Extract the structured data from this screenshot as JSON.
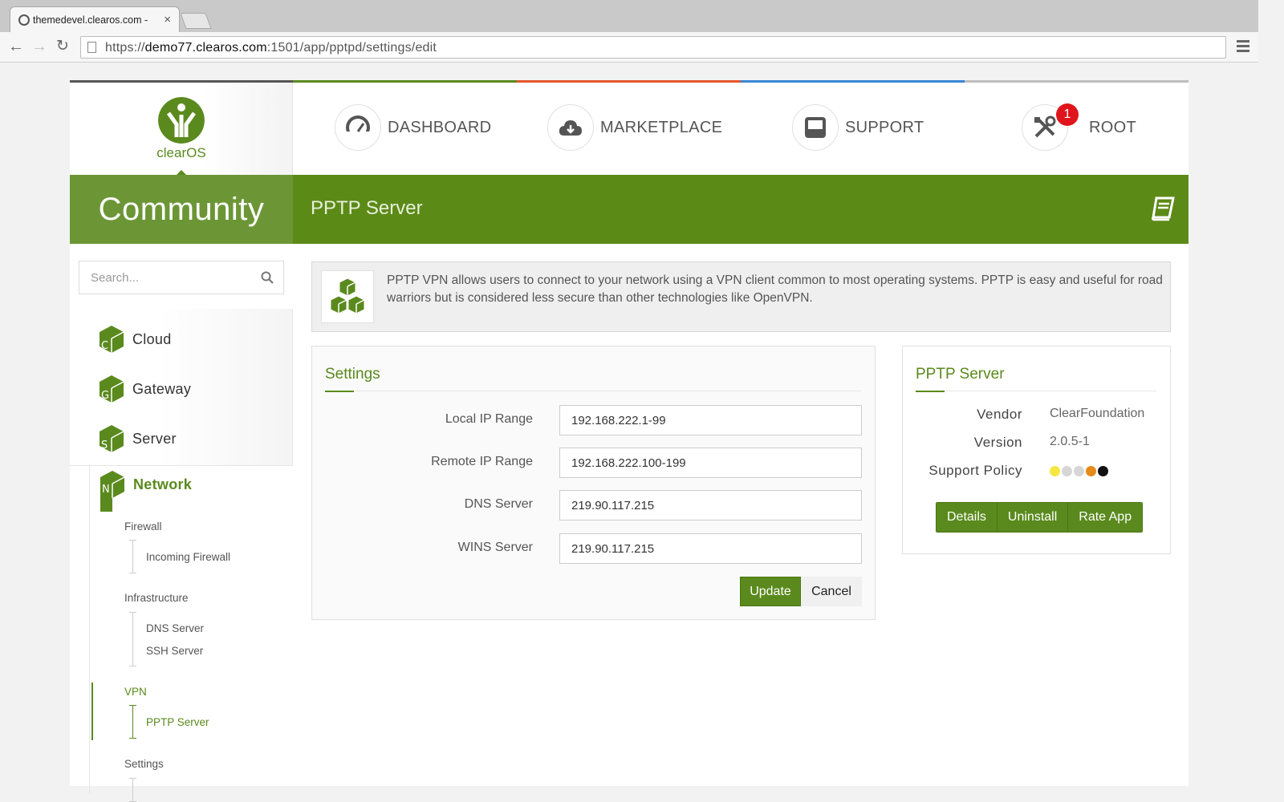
{
  "browser": {
    "tab_title": "themedevel.clearos.com -",
    "tab_close": "×",
    "url_prefix": "https://",
    "url_host": "demo77.clearos.com",
    "url_rest": ":1501/app/pptpd/settings/edit"
  },
  "header": {
    "logo_text": "clearOS",
    "nav": [
      {
        "label": "DASHBOARD",
        "icon": "dashboard-gauge-icon"
      },
      {
        "label": "MARKETPLACE",
        "icon": "cloud-download-icon"
      },
      {
        "label": "SUPPORT",
        "icon": "inbox-icon"
      },
      {
        "label": "ROOT",
        "icon": "tools-icon",
        "badge": "1"
      }
    ],
    "edition": "Community",
    "page_title": "PPTP Server",
    "accent_colors": [
      "#5a8a1d",
      "#e4572e",
      "#3a87d6",
      "#bdbdbd"
    ]
  },
  "sidebar": {
    "search_placeholder": "Search...",
    "categories": [
      {
        "label": "Cloud",
        "letter": "C"
      },
      {
        "label": "Gateway",
        "letter": "G"
      },
      {
        "label": "Server",
        "letter": "S"
      },
      {
        "label": "Network",
        "letter": "N"
      }
    ],
    "groups": [
      {
        "label": "Firewall",
        "items": [
          "Incoming Firewall"
        ]
      },
      {
        "label": "Infrastructure",
        "items": [
          "DNS Server",
          "SSH Server"
        ]
      },
      {
        "label": "VPN",
        "items": [
          "PPTP Server"
        ]
      },
      {
        "label": "Settings",
        "items": []
      }
    ]
  },
  "info": {
    "text": "PPTP VPN allows users to connect to your network using a VPN client common to most operating systems. PPTP is easy and useful for road warriors but is considered less secure than other technologies like OpenVPN."
  },
  "settings": {
    "title": "Settings",
    "fields": [
      {
        "label": "Local IP Range",
        "value": "192.168.222.1-99"
      },
      {
        "label": "Remote IP Range",
        "value": "192.168.222.100-199"
      },
      {
        "label": "DNS Server",
        "value": "219.90.117.215"
      },
      {
        "label": "WINS Server",
        "value": "219.90.117.215"
      }
    ],
    "update_label": "Update",
    "cancel_label": "Cancel"
  },
  "app_info": {
    "title": "PPTP Server",
    "vendor_label": "Vendor",
    "vendor": "ClearFoundation",
    "version_label": "Version",
    "version": "2.0.5-1",
    "support_label": "Support Policy",
    "support_dots": [
      "#f5e642",
      "#d6d6d6",
      "#d6d6d6",
      "#e88a1a",
      "#111111"
    ],
    "buttons": [
      "Details",
      "Uninstall",
      "Rate App"
    ]
  }
}
